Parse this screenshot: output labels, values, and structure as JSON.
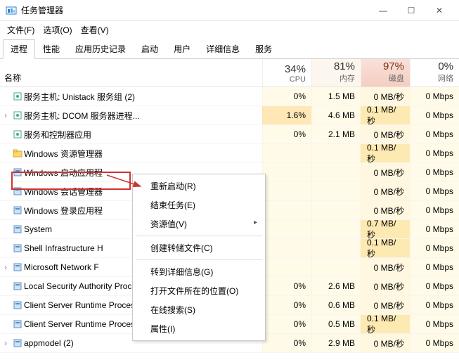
{
  "window": {
    "title": "任务管理器"
  },
  "menus": [
    "文件(F)",
    "选项(O)",
    "查看(V)"
  ],
  "tabs": [
    "进程",
    "性能",
    "应用历史记录",
    "启动",
    "用户",
    "详细信息",
    "服务"
  ],
  "activeTab": 0,
  "columns": {
    "name": "名称",
    "cpu": {
      "pct": "34%",
      "label": "CPU"
    },
    "mem": {
      "pct": "81%",
      "label": "内存"
    },
    "disk": {
      "pct": "97%",
      "label": "磁盘"
    },
    "net": {
      "pct": "0%",
      "label": "网络"
    }
  },
  "rows": [
    {
      "exp": "",
      "name": "服务主机: Unistack 服务组 (2)",
      "cpu": "0%",
      "mem": "1.5 MB",
      "disk": "0 MB/秒",
      "net": "0 Mbps",
      "icon": "svc"
    },
    {
      "exp": "›",
      "name": "服务主机: DCOM 服务器进程...",
      "cpu": "1.6%",
      "mem": "4.6 MB",
      "disk": "0.1 MB/秒",
      "net": "0 Mbps",
      "heatCpu": 1,
      "heatDisk": 1,
      "icon": "svc"
    },
    {
      "exp": "",
      "name": "服务和控制器应用",
      "cpu": "0%",
      "mem": "2.1 MB",
      "disk": "0 MB/秒",
      "net": "0 Mbps",
      "icon": "svc"
    },
    {
      "exp": "",
      "name": "Windows 资源管理器",
      "cpu": "",
      "mem": "",
      "disk": "0.1 MB/秒",
      "net": "0 Mbps",
      "selected": true,
      "heatDisk": 1,
      "icon": "explorer"
    },
    {
      "exp": "",
      "name": "Windows 启动应用程",
      "cpu": "",
      "mem": "",
      "disk": "0 MB/秒",
      "net": "0 Mbps",
      "icon": "app"
    },
    {
      "exp": "",
      "name": "Windows 会话管理器",
      "cpu": "",
      "mem": "",
      "disk": "0 MB/秒",
      "net": "0 Mbps",
      "icon": "app"
    },
    {
      "exp": "",
      "name": "Windows 登录应用程",
      "cpu": "",
      "mem": "",
      "disk": "0 MB/秒",
      "net": "0 Mbps",
      "icon": "app"
    },
    {
      "exp": "",
      "name": "System",
      "cpu": "",
      "mem": "",
      "disk": "0.7 MB/秒",
      "net": "0 Mbps",
      "heatDisk": 1,
      "icon": "app"
    },
    {
      "exp": "",
      "name": "Shell Infrastructure H",
      "cpu": "",
      "mem": "",
      "disk": "0.1 MB/秒",
      "net": "0 Mbps",
      "heatDisk": 1,
      "icon": "app"
    },
    {
      "exp": "›",
      "name": "Microsoft Network F",
      "cpu": "",
      "mem": "",
      "disk": "0 MB/秒",
      "net": "0 Mbps",
      "icon": "app"
    },
    {
      "exp": "",
      "name": "Local Security Authority Proc...",
      "cpu": "0%",
      "mem": "2.6 MB",
      "disk": "0 MB/秒",
      "net": "0 Mbps",
      "icon": "app"
    },
    {
      "exp": "",
      "name": "Client Server Runtime Process",
      "cpu": "0%",
      "mem": "0.6 MB",
      "disk": "0 MB/秒",
      "net": "0 Mbps",
      "icon": "app"
    },
    {
      "exp": "",
      "name": "Client Server Runtime Process",
      "cpu": "0%",
      "mem": "0.5 MB",
      "disk": "0.1 MB/秒",
      "net": "0 Mbps",
      "heatDisk": 1,
      "icon": "app"
    },
    {
      "exp": "›",
      "name": "appmodel (2)",
      "cpu": "0%",
      "mem": "2.9 MB",
      "disk": "0 MB/秒",
      "net": "0 Mbps",
      "icon": "app"
    }
  ],
  "contextMenu": {
    "items": [
      {
        "label": "重新启动(R)",
        "type": "item"
      },
      {
        "label": "结束任务(E)",
        "type": "item"
      },
      {
        "label": "资源值(V)",
        "type": "sub"
      },
      {
        "type": "sep"
      },
      {
        "label": "创建转储文件(C)",
        "type": "item"
      },
      {
        "type": "sep"
      },
      {
        "label": "转到详细信息(G)",
        "type": "item"
      },
      {
        "label": "打开文件所在的位置(O)",
        "type": "item"
      },
      {
        "label": "在线搜索(S)",
        "type": "item"
      },
      {
        "label": "属性(I)",
        "type": "item"
      }
    ]
  }
}
